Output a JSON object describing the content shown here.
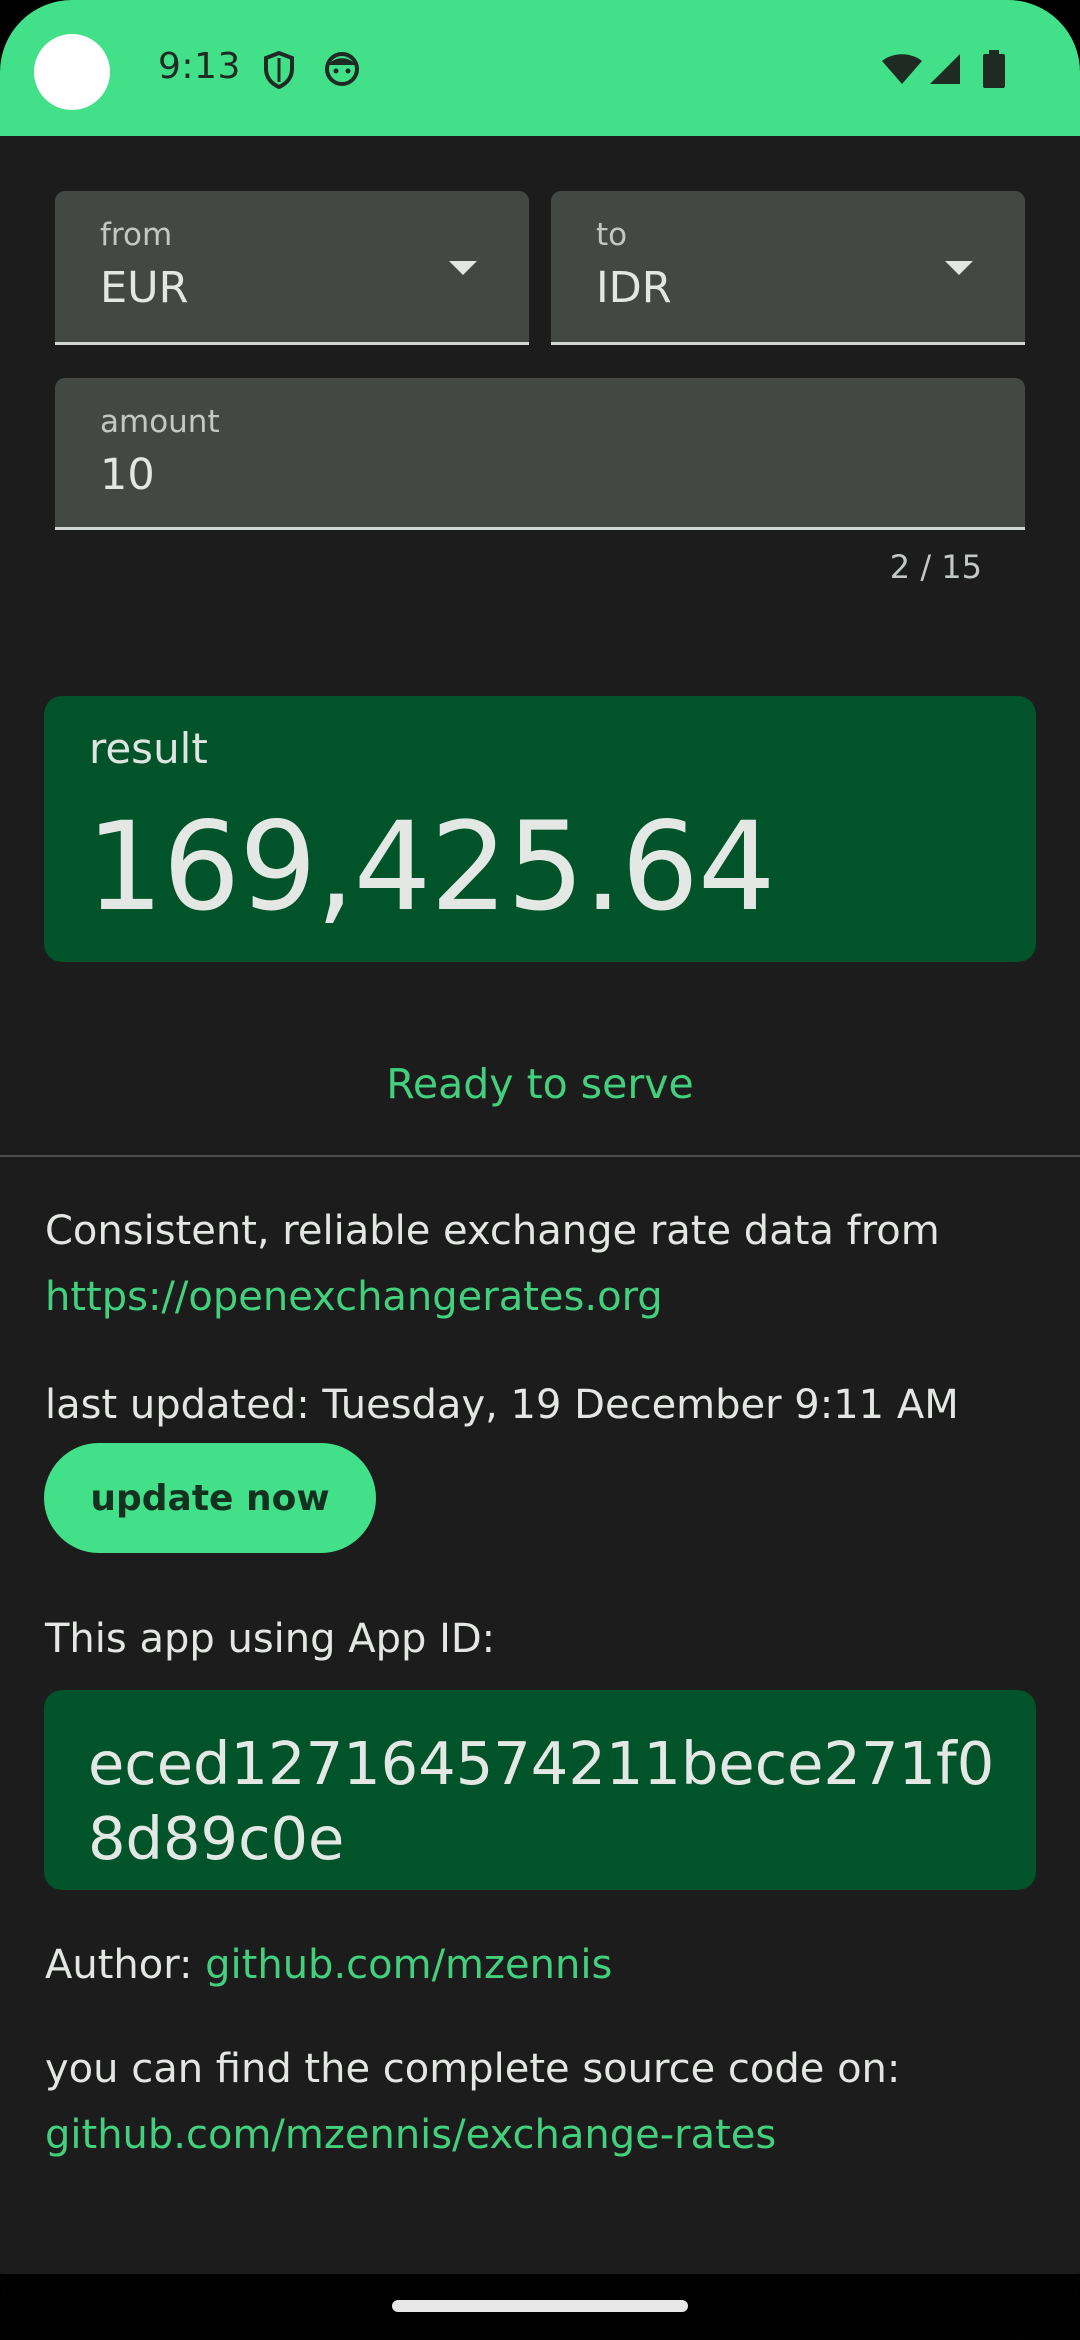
{
  "status_bar": {
    "time": "9:13",
    "icons_left": [
      "shield-icon",
      "face-icon"
    ],
    "icons_right": [
      "wifi-icon",
      "signal-icon",
      "battery-icon"
    ],
    "background_color": "#43e08a"
  },
  "converter": {
    "from": {
      "label": "from",
      "value": "EUR"
    },
    "to": {
      "label": "to",
      "value": "IDR"
    },
    "amount": {
      "label": "amount",
      "value": "10",
      "counter": "2 / 15"
    }
  },
  "result": {
    "label": "result",
    "value": "169,425.64"
  },
  "status_message": "Ready to serve",
  "info": {
    "source_text": "Consistent, reliable exchange rate data from",
    "source_link": "https://openexchangerates.org",
    "last_updated": "last updated: Tuesday, 19 December 9:11 AM",
    "update_button": "update now",
    "app_id_label": "This app using App ID:",
    "app_id": "eced127164574211bece271f08d89c0e",
    "author_label": "Author: ",
    "author_link": "github.com/mzennis",
    "source_code_text": "you can find the complete source code on:",
    "source_code_link": "github.com/mzennis/exchange-rates"
  },
  "colors": {
    "accent": "#43e08a",
    "link": "#43d07e",
    "card": "#01532a",
    "background": "#1b1c1b"
  }
}
